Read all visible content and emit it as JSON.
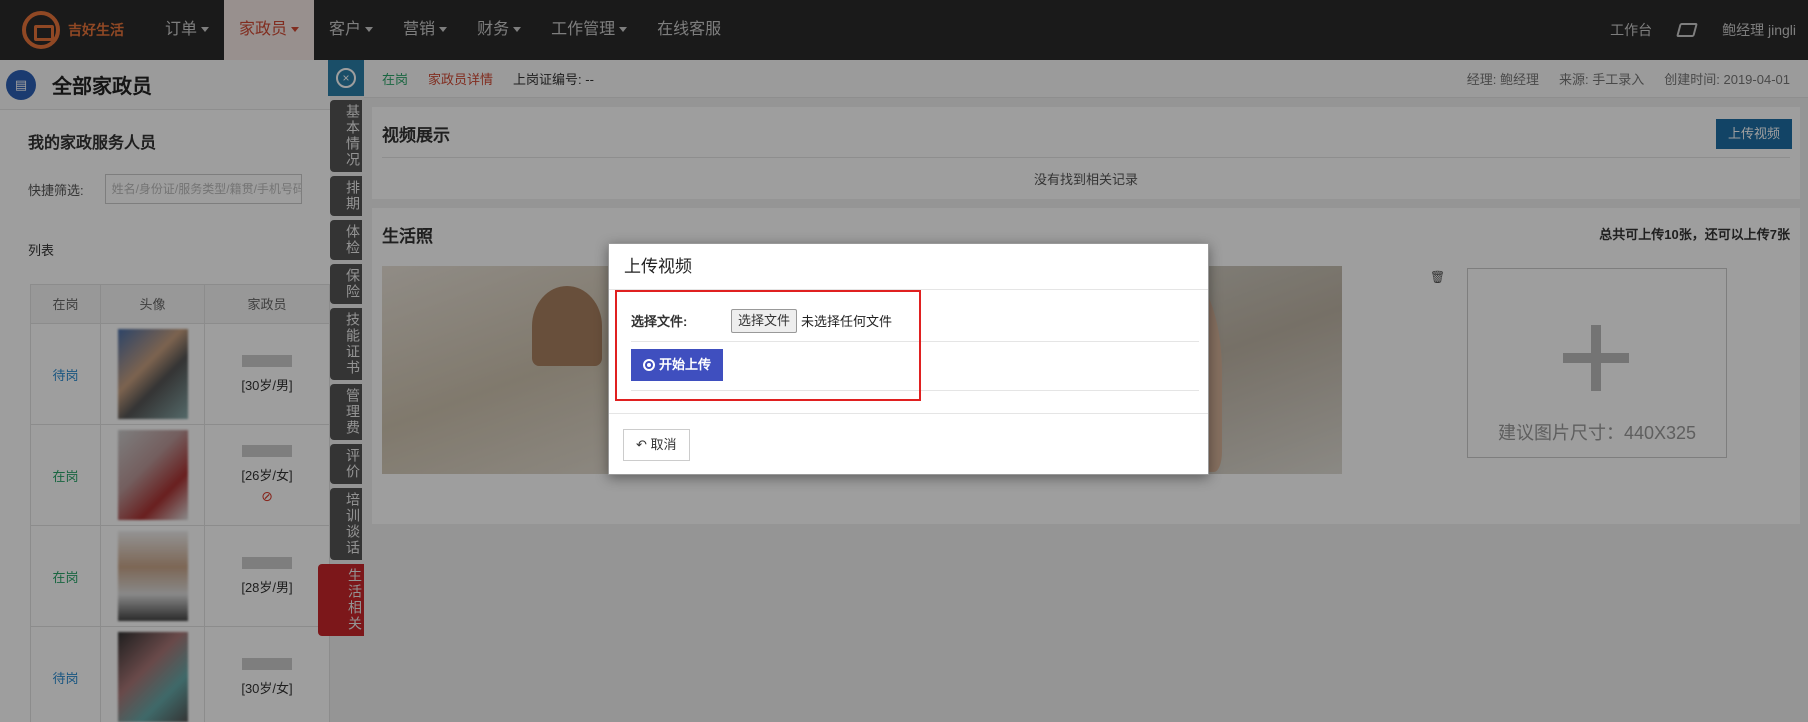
{
  "topbar": {
    "logo_text": "吉好生活",
    "nav": [
      {
        "label": "订单",
        "caret": true,
        "active": false
      },
      {
        "label": "家政员",
        "caret": true,
        "active": true
      },
      {
        "label": "客户",
        "caret": true,
        "active": false
      },
      {
        "label": "营销",
        "caret": true,
        "active": false
      },
      {
        "label": "财务",
        "caret": true,
        "active": false
      },
      {
        "label": "工作管理",
        "caret": true,
        "active": false
      },
      {
        "label": "在线客服",
        "caret": false,
        "active": false
      }
    ],
    "workbench": "工作台",
    "user": "鲍经理  jingli"
  },
  "left": {
    "page_title": "全部家政员",
    "section_title": "我的家政服务人员",
    "filter_label": "快捷筛选:",
    "filter_placeholder": "姓名/身份证/服务类型/籍贯/手机号码",
    "list_label": "列表",
    "columns": [
      "在岗",
      "头像",
      "家政员"
    ],
    "rows": [
      {
        "status": "待岗",
        "info": "[30岁/男]",
        "banned": false
      },
      {
        "status": "在岗",
        "info": "[26岁/女]",
        "banned": true
      },
      {
        "status": "在岗",
        "info": "[28岁/男]",
        "banned": false
      },
      {
        "status": "待岗",
        "info": "[30岁/女]",
        "banned": false
      }
    ]
  },
  "vtabs": {
    "items": [
      "基本情况",
      "排期",
      "体检",
      "保险",
      "技能证书",
      "管理费",
      "评价",
      "培训谈话",
      "生活相关"
    ],
    "active": "生活相关"
  },
  "infobar": {
    "status": "在岗",
    "detail": "家政员详情",
    "cert_no": "上岗证编号: --",
    "manager": "经理: 鲍经理",
    "source": "来源: 手工录入",
    "created": "创建时间: 2019-04-01"
  },
  "video": {
    "title": "视频展示",
    "upload_btn": "上传视频",
    "empty": "没有找到相关记录"
  },
  "photos": {
    "title": "生活照",
    "quota": "总共可上传10张，还可以上传7张",
    "add_tip": "建议图片尺寸：440X325"
  },
  "modal": {
    "title": "上传视频",
    "file_label": "选择文件:",
    "file_button": "选择文件",
    "file_hint": "未选择任何文件",
    "start_upload": "开始上传",
    "cancel": "取消"
  },
  "colors": {
    "accent": "#d04a34",
    "primary_btn": "#1d6fa5",
    "upload_btn": "#3f4fbf",
    "highlight": "#e02020"
  }
}
